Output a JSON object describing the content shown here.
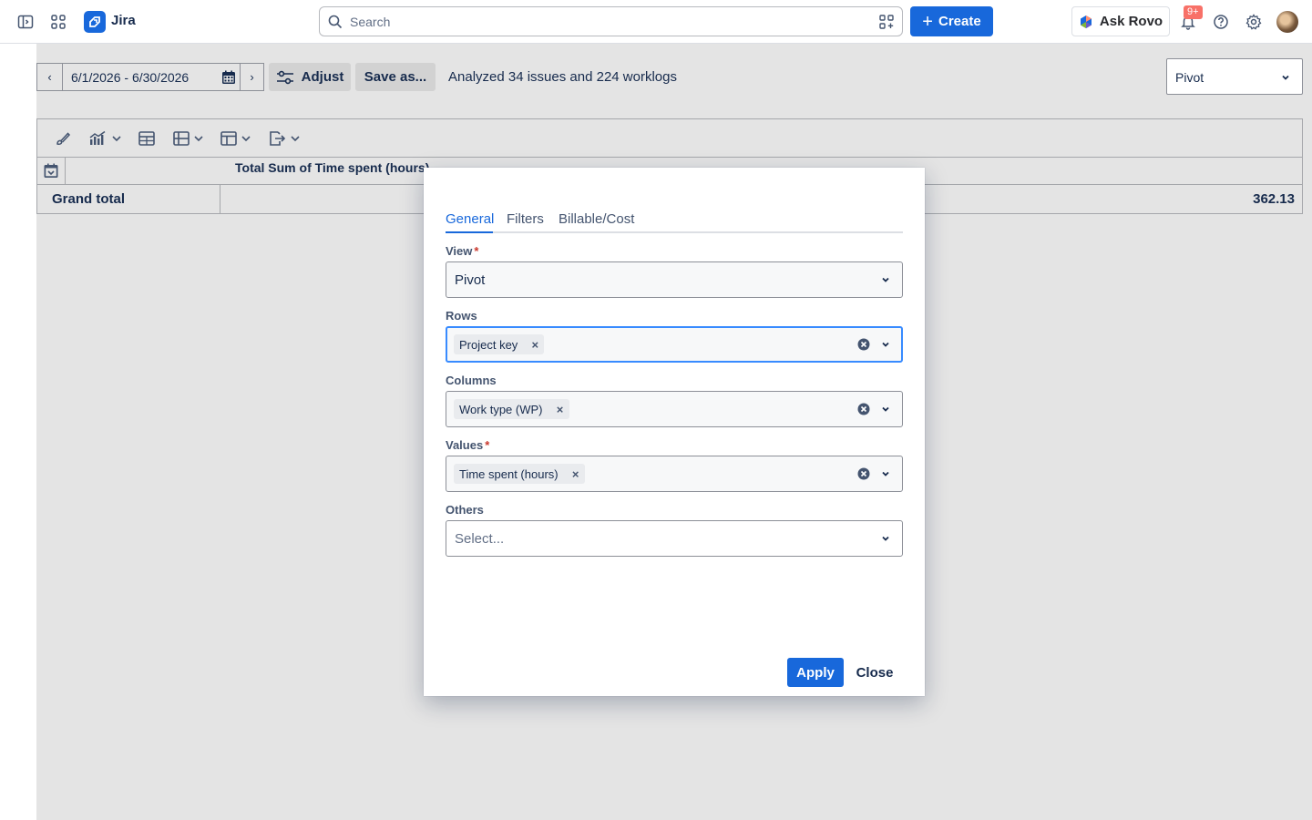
{
  "topbar": {
    "app_name": "Jira",
    "search_placeholder": "Search",
    "create_label": "Create",
    "ask_rovo_label": "Ask Rovo",
    "notification_badge": "9+",
    "brand_color": "#1868db"
  },
  "toolbar": {
    "date_range": "6/1/2026 - 6/30/2026",
    "prev_arrow": "‹",
    "next_arrow": "›",
    "adjust_label": "Adjust",
    "save_as_label": "Save as...",
    "analyzed_text": "Analyzed 34 issues and 224 worklogs",
    "view_select_value": "Pivot"
  },
  "pivot_table": {
    "header": "Total Sum of Time spent (hours)",
    "grand_total_label": "Grand total",
    "grand_total_value": "362.13"
  },
  "modal": {
    "tabs": [
      "General",
      "Filters",
      "Billable/Cost"
    ],
    "active_tab": "General",
    "fields": {
      "view": {
        "label": "View",
        "required": true,
        "value": "Pivot"
      },
      "rows": {
        "label": "Rows",
        "required": false,
        "chips": [
          "Project key"
        ]
      },
      "columns": {
        "label": "Columns",
        "required": false,
        "chips": [
          "Work type (WP)"
        ]
      },
      "values": {
        "label": "Values",
        "required": true,
        "chips": [
          "Time spent (hours)"
        ]
      },
      "others": {
        "label": "Others",
        "required": false,
        "placeholder": "Select..."
      }
    },
    "required_marker": "*",
    "chip_remove": "×",
    "apply_label": "Apply",
    "close_label": "Close"
  }
}
